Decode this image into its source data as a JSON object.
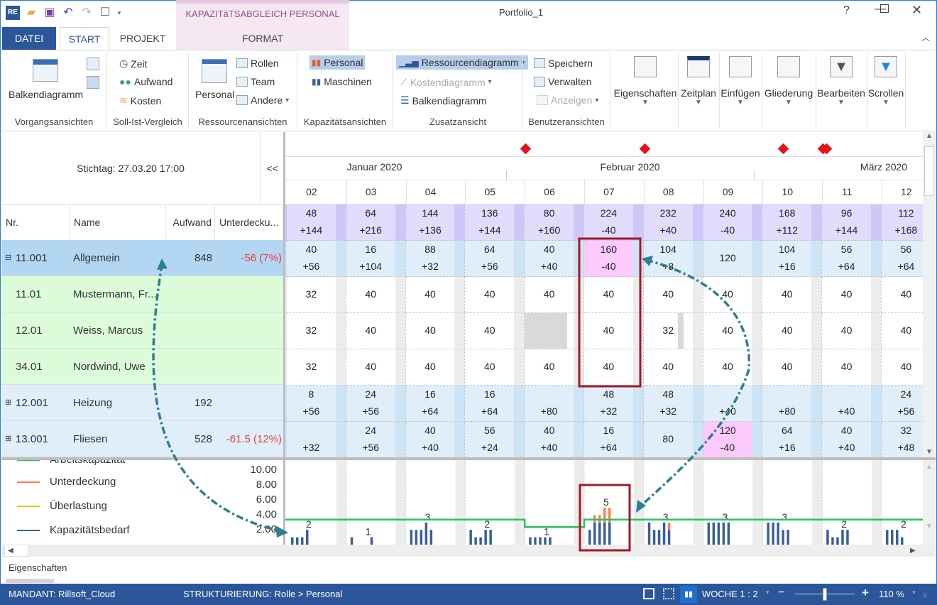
{
  "window": {
    "title": "Portfolio_1",
    "context_tab_group": "KAPAZITäTSABGLEICH PERSONAL"
  },
  "tabs": [
    {
      "label": "DATEI"
    },
    {
      "label": "START"
    },
    {
      "label": "PROJEKT"
    },
    {
      "label": "FORMAT"
    }
  ],
  "ribbon": {
    "vorgang": {
      "big": "Balkendiagramm",
      "label": "Vorgangsansichten"
    },
    "soll": {
      "items": [
        "Zeit",
        "Aufwand",
        "Kosten"
      ],
      "label": "Soll-Ist-Vergleich"
    },
    "ressourcen": {
      "big": "Personal",
      "items": [
        "Rollen",
        "Team",
        "Andere"
      ],
      "label": "Ressourcenansichten"
    },
    "kapazitaet": {
      "items": [
        "Personal",
        "Maschinen"
      ],
      "label": "Kapazitätsansichten"
    },
    "zusatz": {
      "items": [
        "Ressourcendiagramm",
        "Kostendiagramm",
        "Balkendiagramm"
      ],
      "label": "Zusatzansicht"
    },
    "benutzer": {
      "items": [
        "Speichern",
        "Verwalten",
        "Anzeigen"
      ],
      "label": "Benutzeransichten"
    },
    "big_buttons": [
      "Eigenschaften",
      "Zeitplan",
      "Einfügen",
      "Gliederung",
      "Bearbeiten",
      "Scrollen"
    ]
  },
  "left": {
    "stichtag": "Stichtag: 27.03.20 17:00",
    "collapse": "<<",
    "columns": [
      "Nr.",
      "Name",
      "Aufwand",
      "Unterdecku..."
    ],
    "rows": [
      {
        "nr": "11.001",
        "name": "Allgemein",
        "aufwand": "848",
        "unter": "-56 (7%)",
        "type": "group",
        "expand": "⊟"
      },
      {
        "nr": "11.01",
        "name": "Mustermann, Fr...",
        "aufwand": "",
        "unter": "",
        "type": "person"
      },
      {
        "nr": "12.01",
        "name": "Weiss, Marcus",
        "aufwand": "",
        "unter": "",
        "type": "person"
      },
      {
        "nr": "34.01",
        "name": "Nordwind, Uwe",
        "aufwand": "",
        "unter": "",
        "type": "person"
      },
      {
        "nr": "12.001",
        "name": "Heizung",
        "aufwand": "192",
        "unter": "",
        "type": "group2",
        "expand": "⊞"
      },
      {
        "nr": "13.001",
        "name": "Fliesen",
        "aufwand": "528",
        "unter": "-61.5 (12%)",
        "type": "group2",
        "expand": "⊞"
      }
    ]
  },
  "timeline": {
    "months": [
      "Januar 2020",
      "Februar 2020",
      "März 2020"
    ],
    "weeks": [
      "02",
      "03",
      "04",
      "05",
      "06",
      "07",
      "08",
      "09",
      "10",
      "11",
      "12"
    ]
  },
  "grid": {
    "totals": [
      [
        "48",
        "+144"
      ],
      [
        "64",
        "+216"
      ],
      [
        "144",
        "+136"
      ],
      [
        "136",
        "+144"
      ],
      [
        "80",
        "+160"
      ],
      [
        "224",
        "-40"
      ],
      [
        "232",
        "+40"
      ],
      [
        "240",
        "-40"
      ],
      [
        "168",
        "+112"
      ],
      [
        "96",
        "+144"
      ],
      [
        "112",
        "+168"
      ]
    ],
    "rows": [
      [
        [
          "40",
          "+56"
        ],
        [
          "16",
          "+104"
        ],
        [
          "88",
          "+32"
        ],
        [
          "64",
          "+56"
        ],
        [
          "40",
          "+40"
        ],
        [
          "160",
          "-40",
          "pink"
        ],
        [
          "104",
          "+8"
        ],
        [
          "120"
        ],
        [
          "104",
          "+16"
        ],
        [
          "56",
          "+64"
        ],
        [
          "56",
          "+64"
        ]
      ],
      [
        [
          "32"
        ],
        [
          "40"
        ],
        [
          "40"
        ],
        [
          "40"
        ],
        [
          "40"
        ],
        [
          "40"
        ],
        [
          "40"
        ],
        [
          "40"
        ],
        [
          "40"
        ],
        [
          "40"
        ],
        [
          "40"
        ]
      ],
      [
        [
          "32"
        ],
        [
          "40"
        ],
        [
          "40"
        ],
        [
          "40"
        ],
        [
          "",
          "",
          "gray"
        ],
        [
          "40"
        ],
        [
          "32"
        ],
        [
          "40"
        ],
        [
          "40"
        ],
        [
          "40"
        ],
        [
          "40"
        ]
      ],
      [
        [
          "32"
        ],
        [
          "40"
        ],
        [
          "40"
        ],
        [
          "40"
        ],
        [
          "40"
        ],
        [
          "40"
        ],
        [
          "40"
        ],
        [
          "40"
        ],
        [
          "40"
        ],
        [
          "40"
        ],
        [
          "40"
        ]
      ],
      [
        [
          "8",
          "+56"
        ],
        [
          "24",
          "+56"
        ],
        [
          "16",
          "+64"
        ],
        [
          "16",
          "+64"
        ],
        [
          "",
          "+80"
        ],
        [
          "48",
          "+32"
        ],
        [
          "48",
          "+32"
        ],
        [
          "",
          "+40"
        ],
        [
          "",
          "+80"
        ],
        [
          "",
          "+40"
        ],
        [
          "24",
          "+56"
        ]
      ],
      [
        [
          "",
          "+32"
        ],
        [
          "24",
          "+56"
        ],
        [
          "40",
          "+40"
        ],
        [
          "56",
          "+24"
        ],
        [
          "40",
          "+40"
        ],
        [
          "16",
          "+64"
        ],
        [
          "80"
        ],
        [
          "120",
          "-40",
          "pink"
        ],
        [
          "64",
          "+16"
        ],
        [
          "40",
          "+40"
        ],
        [
          "32",
          "+48"
        ]
      ]
    ]
  },
  "chart_data": {
    "type": "bar",
    "categories": [
      "02",
      "03",
      "04",
      "05",
      "06",
      "07",
      "08",
      "09",
      "10",
      "11",
      "12"
    ],
    "ylim": [
      0,
      10
    ],
    "yticks": [
      "10.00",
      "8.00",
      "6.00",
      "4.00",
      "2.00"
    ],
    "legend": [
      "Arbeitskapazität",
      "Unterdeckung",
      "Überlastung",
      "Kapazitätsbedarf"
    ],
    "colors": {
      "Arbeitskapazität": "#22c55e",
      "Unterdeckung": "#ff7f50",
      "Überlastung": "#f5c400",
      "Kapazitätsbedarf": "#3a5f99"
    },
    "series": [
      {
        "name": "Kapazitätsbedarf",
        "values": [
          [
            1,
            1,
            1,
            2
          ],
          [
            1,
            0,
            0,
            0,
            1
          ],
          [
            2,
            2,
            2,
            3,
            2
          ],
          [
            2,
            1,
            1,
            2,
            2
          ],
          [
            1,
            1,
            1,
            1,
            1
          ],
          [
            2,
            3,
            3,
            3,
            3
          ],
          [
            3,
            2,
            2,
            3,
            2
          ],
          [
            3,
            3,
            3,
            3,
            3
          ],
          [
            3,
            3,
            3,
            2,
            2
          ],
          [
            2,
            1,
            1,
            2,
            2
          ],
          [
            2,
            2,
            2,
            1
          ]
        ]
      },
      {
        "name": "Unterdeckung",
        "values": [
          [
            0,
            0,
            0,
            0
          ],
          [
            0,
            0,
            0,
            0,
            0
          ],
          [
            0,
            0,
            0,
            0,
            0
          ],
          [
            0,
            0,
            0,
            0,
            0
          ],
          [
            0,
            0,
            0,
            0,
            0
          ],
          [
            0,
            1,
            1,
            2,
            2
          ],
          [
            0,
            0,
            0,
            0,
            1
          ],
          [
            0,
            0,
            0,
            0,
            0
          ],
          [
            0,
            0,
            0,
            0,
            0
          ],
          [
            0,
            0,
            0,
            0,
            0
          ],
          [
            0,
            0,
            0,
            0
          ]
        ]
      },
      {
        "name": "Arbeitskapazität",
        "values": [
          3,
          3,
          3,
          3,
          2,
          3,
          3,
          3,
          3,
          3,
          3
        ]
      }
    ],
    "labels": [
      "2",
      "1",
      "3",
      "2",
      "1",
      "5",
      "3",
      "3",
      "3",
      "2",
      "2"
    ]
  },
  "bottom": {
    "panel": "Eigenschaften"
  },
  "status": {
    "mandant": "MANDANT: Rillsoft_Cloud",
    "struktur": "STRUKTURIERUNG: Rolle > Personal",
    "scale": "WOCHE 1 : 2",
    "zoom": "110 %",
    "zoom_slider_percent": 50
  }
}
